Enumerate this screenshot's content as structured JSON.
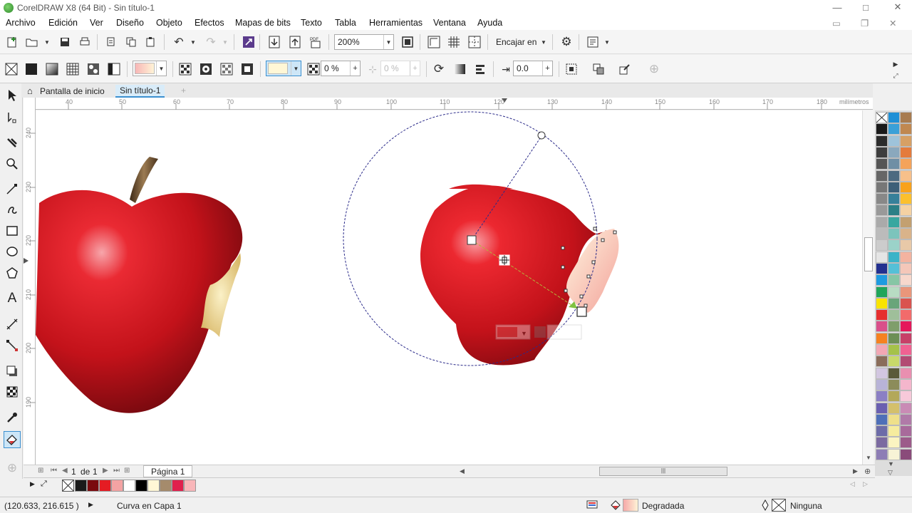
{
  "window": {
    "title": "CorelDRAW X8 (64 Bit) - Sin título-1",
    "controls": [
      "—",
      "□",
      "✕"
    ],
    "mdi_controls": [
      "▭",
      "❐",
      "✕"
    ]
  },
  "menu": [
    "Archivo",
    "Edición",
    "Ver",
    "Diseño",
    "Objeto",
    "Efectos",
    "Mapas de bits",
    "Texto",
    "Tabla",
    "Herramientas",
    "Ventana",
    "Ayuda"
  ],
  "toolbar1": {
    "zoom_value": "200%",
    "snap_label": "Encajar en"
  },
  "toolbar2": {
    "transparency_value": "0 %",
    "transparency_value2": "0 %",
    "offset_value": "0.0"
  },
  "tabs": {
    "home_label": "Pantalla de inicio",
    "doc_label": "Sin título-1",
    "add_label": "+"
  },
  "ruler": {
    "units": "milímetros",
    "h_ticks": [
      "40",
      "50",
      "60",
      "70",
      "80",
      "90",
      "100",
      "110",
      "120",
      "130",
      "140",
      "150",
      "160",
      "170",
      "180"
    ],
    "v_ticks": [
      "240",
      "230",
      "220",
      "210",
      "200",
      "190"
    ]
  },
  "page_nav": {
    "current": "1",
    "of_label": "de",
    "total": "1",
    "page_tab": "Página 1"
  },
  "status": {
    "coords": "(120.633, 216.615 )",
    "object_info": "Curva en Capa 1",
    "fill_label": "Degradada",
    "outline_label": "Ninguna"
  },
  "colors": {
    "accent_selection": "#cde6f7",
    "apple_red": "#d6151c",
    "apple_dark": "#7a0a0e",
    "bite_cream": "#f2e2a0"
  },
  "palette_colors": [
    [
      "#ffffff",
      "#1e8fd6",
      "#a87b4f"
    ],
    [
      "#1a1a1a",
      "#3aa0d8",
      "#c08850"
    ],
    [
      "#2b2b2b",
      "#9ec3da",
      "#d7a064"
    ],
    [
      "#3d3d3d",
      "#8aa8bd",
      "#e47b3c"
    ],
    [
      "#555555",
      "#6f8fa5",
      "#f4a35a"
    ],
    [
      "#666666",
      "#4c6a80",
      "#f7c08a"
    ],
    [
      "#777777",
      "#3d5f78",
      "#f9a21b"
    ],
    [
      "#888888",
      "#37809a",
      "#fbc02d"
    ],
    [
      "#999999",
      "#2c7f86",
      "#f5d2a3"
    ],
    [
      "#aaaaaa",
      "#39a7a0",
      "#c3a070"
    ],
    [
      "#bbbbbb",
      "#7cc4bc",
      "#d9b38a"
    ],
    [
      "#cccccc",
      "#9bd2c9",
      "#e8c9a8"
    ],
    [
      "#e5e5e5",
      "#3bb3c8",
      "#f3b3a0"
    ],
    [
      "#23308f",
      "#55c0d7",
      "#f4c7b9"
    ],
    [
      "#1e9be0",
      "#86c6a5",
      "#f7d8cc"
    ],
    [
      "#20a55a",
      "#b7dcc3",
      "#e9967a"
    ],
    [
      "#f9e400",
      "#69a57a",
      "#d9534f"
    ],
    [
      "#e62e2e",
      "#9fbf9a",
      "#f26b6b"
    ],
    [
      "#d94f8a",
      "#7f9e6b",
      "#e5175b"
    ],
    [
      "#f58220",
      "#6d8f55",
      "#c74068"
    ],
    [
      "#f2a7b4",
      "#a5c24a",
      "#f06292"
    ],
    [
      "#8a6d5a",
      "#c8d96a",
      "#b24b73"
    ],
    [
      "#d2c6e0",
      "#5a5a3a",
      "#e98fb0"
    ],
    [
      "#b8b3d8",
      "#8c8c5a",
      "#f4b6cc"
    ],
    [
      "#8b7fc4",
      "#b3a85a",
      "#f7c9da"
    ],
    [
      "#6a5fb0",
      "#d4c06b",
      "#c98bb5"
    ],
    [
      "#4e6fb8",
      "#efe08a",
      "#b07aa8"
    ],
    [
      "#6d6ca8",
      "#f6ec9e",
      "#a86a9b"
    ],
    [
      "#7b6aa0",
      "#fbf4c1",
      "#9c5b8a"
    ],
    [
      "#8d7db5",
      "#f7f3d6",
      "#8a4b7a"
    ]
  ],
  "doc_palette_colors": [
    "#1a1a1a",
    "#7a0a0e",
    "#e51c23",
    "#f4a3a3",
    "#ffffff",
    "#000000",
    "#fff7d6",
    "#a58b6c",
    "#e0204d",
    "#f9b6b9"
  ]
}
